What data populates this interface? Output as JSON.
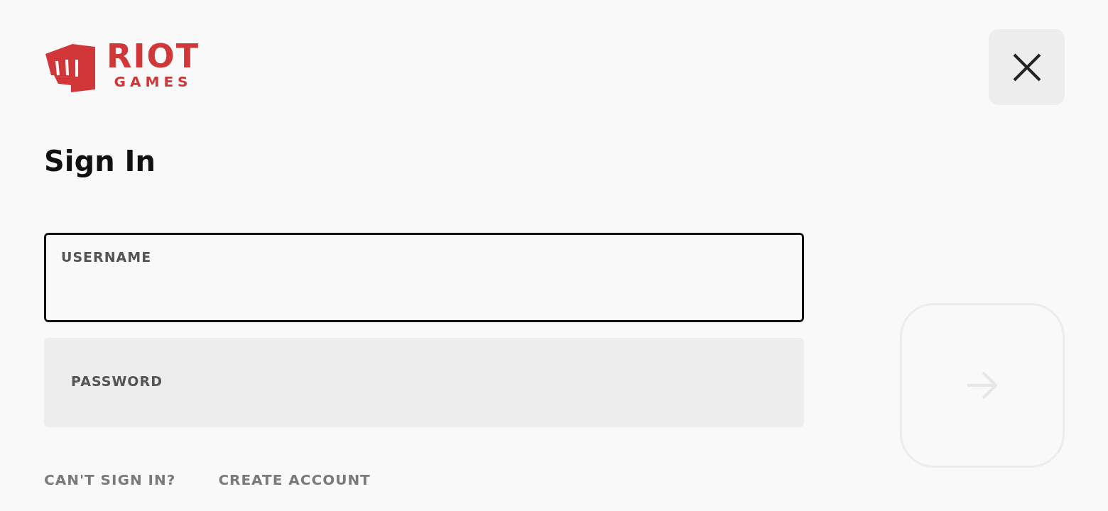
{
  "logo": {
    "line_1": "RIOT",
    "line_2": "GAMES"
  },
  "heading": "Sign In",
  "fields": [
    {
      "label": "USERNAME",
      "focused": true
    },
    {
      "label": "PASSWORD",
      "focused": false
    }
  ],
  "links": [
    "CAN'T SIGN IN?",
    "CREATE ACCOUNT"
  ],
  "submit": {
    "disabled": true
  }
}
